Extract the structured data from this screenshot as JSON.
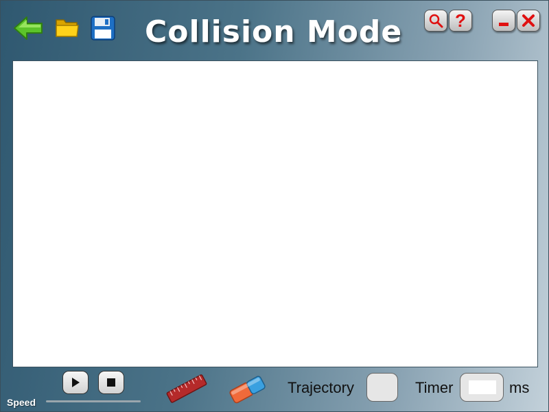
{
  "window": {
    "title": "Collision Mode"
  },
  "toolbar": {
    "icons": [
      "back-arrow-icon",
      "open-folder-icon",
      "save-disk-icon"
    ],
    "zoom_icon": "magnifier-icon",
    "help_icon": "question-mark-icon",
    "minimize_icon": "minimize-icon",
    "close_icon": "close-x-icon"
  },
  "controls": {
    "play_icon": "play-icon",
    "stop_icon": "stop-icon",
    "speed_label": "Speed",
    "ruler_icon": "ruler-icon",
    "eraser_icon": "eraser-icon",
    "trajectory_label": "Trajectory",
    "trajectory_checked": false,
    "timer_label": "Timer",
    "timer_value": "",
    "timer_unit": "ms"
  },
  "colors": {
    "accent_red": "#e01010",
    "folder_yellow": "#f2c200",
    "disk_blue": "#1e6fc4",
    "arrow_green": "#5cc42a",
    "ruler_red": "#b52a2a",
    "eraser_orange": "#f06a3a",
    "eraser_blue": "#3aa0e0"
  }
}
